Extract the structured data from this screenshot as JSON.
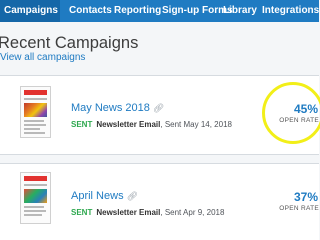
{
  "nav": {
    "items": [
      {
        "label": "Campaigns",
        "active": true
      },
      {
        "label": "Contacts",
        "active": false
      },
      {
        "label": "Reporting",
        "active": false
      },
      {
        "label": "Sign-up Forms",
        "active": false
      },
      {
        "label": "Library",
        "active": false
      },
      {
        "label": "Integrations",
        "active": false
      }
    ]
  },
  "page": {
    "title": "Recent Campaigns",
    "view_all": "View all campaigns"
  },
  "campaigns": [
    {
      "name": "May News 2018",
      "status": "SENT",
      "type": "Newsletter Email",
      "date": ", Sent May 14, 2018",
      "open_rate": "45%",
      "open_rate_label": "OPEN RATE"
    },
    {
      "name": "April News",
      "status": "SENT",
      "type": "Newsletter Email",
      "date": ", Sent Apr 9, 2018",
      "open_rate": "37%",
      "open_rate_label": "OPEN RATE"
    }
  ],
  "colors": {
    "nav_bg": "#1f7bc2",
    "link": "#1f7bc2",
    "sent": "#2ea84f",
    "highlight": "#f2ef18"
  },
  "icons": {
    "link_icon": "chain-link-icon"
  }
}
